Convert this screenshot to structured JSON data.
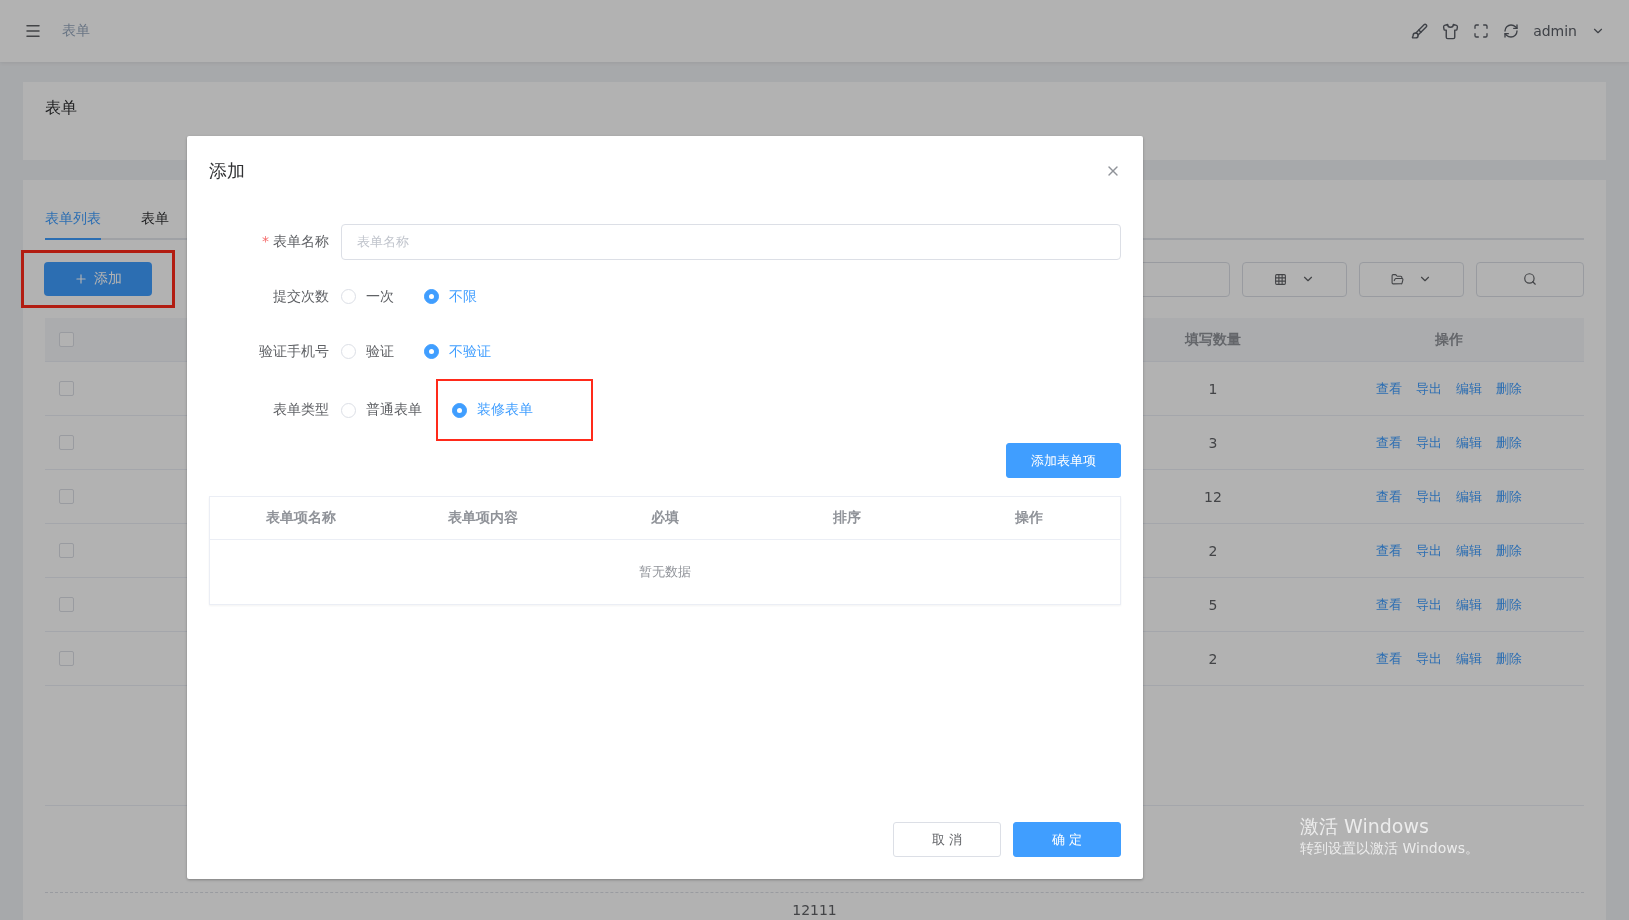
{
  "header": {
    "breadcrumb": "表单",
    "user": "admin"
  },
  "page_title": "表单",
  "tabs": [
    {
      "label": "表单列表",
      "selected": true
    },
    {
      "label": "表单",
      "selected": false
    }
  ],
  "toolbar": {
    "add_button": "添加",
    "add_highlighted": true
  },
  "table": {
    "header_checked": false,
    "columns": [
      "填写数量",
      "操作"
    ],
    "rows": [
      {
        "checked": false,
        "count": "1",
        "actions": [
          "查看",
          "导出",
          "编辑",
          "删除"
        ]
      },
      {
        "checked": false,
        "count": "3",
        "actions": [
          "查看",
          "导出",
          "编辑",
          "删除"
        ]
      },
      {
        "checked": false,
        "count": "12",
        "actions": [
          "查看",
          "导出",
          "编辑",
          "删除"
        ]
      },
      {
        "checked": false,
        "count": "2",
        "actions": [
          "查看",
          "导出",
          "编辑",
          "删除"
        ]
      },
      {
        "checked": false,
        "count": "5",
        "actions": [
          "查看",
          "导出",
          "编辑",
          "删除"
        ]
      },
      {
        "checked": false,
        "count": "2",
        "actions": [
          "查看",
          "导出",
          "编辑",
          "删除"
        ]
      }
    ]
  },
  "footer": "12111",
  "os_notice": [
    "激活 Windows",
    "转到设置以激活 Windows。"
  ],
  "dialog": {
    "title": "添加",
    "fields": [
      {
        "kind": "text",
        "label": "表单名称",
        "required_mark": "*",
        "placeholder": "表单名称"
      },
      {
        "kind": "radio",
        "label": "提交次数",
        "options": [
          {
            "label": "一次",
            "selected": false,
            "highlighted": false
          },
          {
            "label": "不限",
            "selected": true,
            "highlighted": false
          }
        ]
      },
      {
        "kind": "radio",
        "label": "验证手机号",
        "options": [
          {
            "label": "验证",
            "selected": false,
            "highlighted": false
          },
          {
            "label": "不验证",
            "selected": true,
            "highlighted": false
          }
        ]
      },
      {
        "kind": "radio",
        "label": "表单类型",
        "options": [
          {
            "label": "普通表单",
            "selected": false,
            "highlighted": false
          },
          {
            "label": "装修表单",
            "selected": true,
            "highlighted": true
          }
        ]
      }
    ],
    "add_item_button": "添加表单项",
    "items_table": {
      "columns": [
        "表单项名称",
        "表单项内容",
        "必填",
        "排序",
        "操作"
      ],
      "empty_text": "暂无数据"
    },
    "buttons": [
      {
        "label": "取 消",
        "kind": "default"
      },
      {
        "label": "确 定",
        "kind": "primary"
      }
    ]
  }
}
